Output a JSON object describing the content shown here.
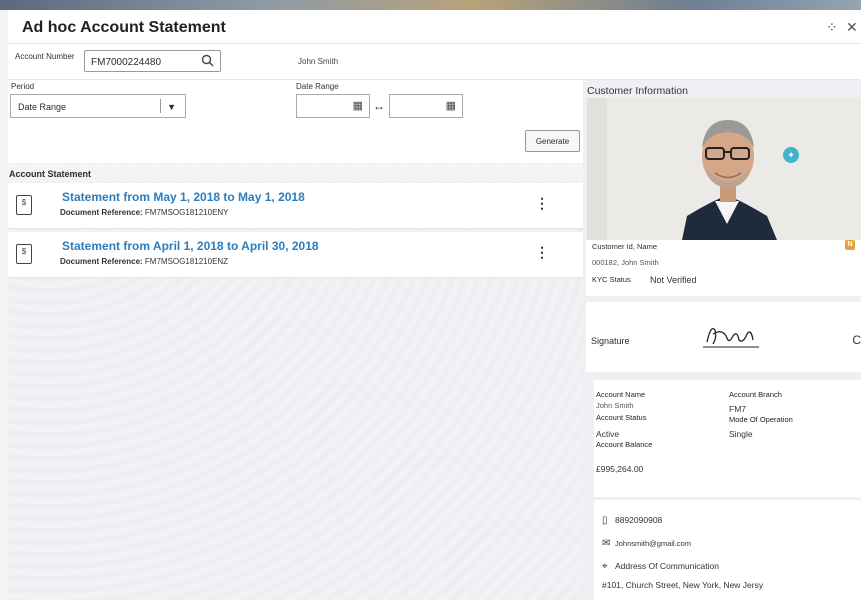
{
  "window": {
    "title": "Ad hoc Account Statement",
    "collapse_glyph": "⁘",
    "close_glyph": "✕"
  },
  "account": {
    "label": "Account Number",
    "value": "FM7000224480",
    "customer_name": "John Smith"
  },
  "period": {
    "label": "Period",
    "selected": "Date Range",
    "date_range_label": "Date Range",
    "from_value": "",
    "to_value": ""
  },
  "generate_label": "Generate",
  "statements": {
    "header": "Account Statement",
    "items": [
      {
        "title": "Statement from May 1, 2018 to May 1, 2018",
        "ref_label": "Document Reference:",
        "ref_value": "FM7MSOG181210ENY"
      },
      {
        "title": "Statement from April 1, 2018 to April 30, 2018",
        "ref_label": "Document Reference:",
        "ref_value": "FM7MSOG181210ENZ"
      }
    ]
  },
  "customer_info": {
    "header": "Customer Information",
    "id_name_label": "Customer Id, Name",
    "id_name_value": "000182, John Smith",
    "kyc_label": "KYC Status",
    "kyc_value": "Not Verified",
    "badge": "N"
  },
  "signature": {
    "label": "Signature",
    "extra": "C"
  },
  "account_details": {
    "account_name_label": "Account Name",
    "account_name_value": "John Smith",
    "account_branch_label": "Account Branch",
    "account_branch_value": "FM7",
    "account_status_label": "Account Status",
    "account_status_value": "Active",
    "mode_label": "Mode Of Operation",
    "mode_value": "Single",
    "balance_label": "Account Balance",
    "balance_value": "£995,264.00"
  },
  "contact": {
    "phone": "8892090908",
    "email": "Johnsmith@gmail.com",
    "address_label": "Address Of Communication",
    "address": "#101, Church Street, New York, New Jersy"
  },
  "icons": {
    "search": "search-icon",
    "calendar": "calendar-icon",
    "kebab": "kebab-menu-icon",
    "document": "document-icon",
    "phone": "phone-icon",
    "email": "email-icon",
    "location": "location-icon"
  },
  "colors": {
    "link_blue": "#2d7dbd",
    "badge_orange": "#e8a23b",
    "assistant_teal": "#43b3c9"
  }
}
